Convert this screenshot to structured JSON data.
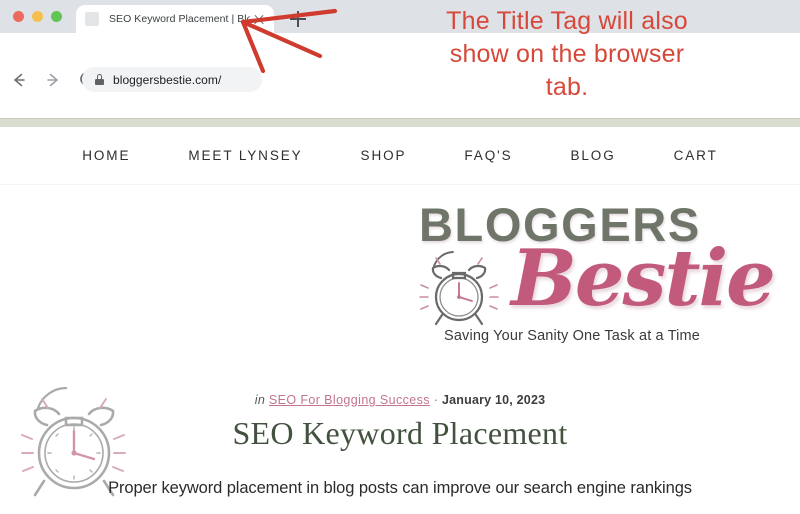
{
  "browser": {
    "traffic_lights": [
      "close",
      "minimize",
      "maximize"
    ],
    "tab": {
      "title": "SEO Keyword Placement | Blo",
      "favicon": "page-icon",
      "close_label": "×"
    },
    "new_tab_label": "+",
    "toolbar": {
      "back_icon": "arrow-left-icon",
      "forward_icon": "arrow-right-icon",
      "reload_icon": "reload-icon",
      "lock_icon": "lock-icon",
      "url": "bloggersbestie.com/"
    }
  },
  "annotation": {
    "text": "The Title Tag will also\nshow on the browser\ntab.",
    "color": "#d6483a",
    "arrow_icon": "arrow-pointing-to-tab"
  },
  "site": {
    "nav": [
      {
        "label": "HOME"
      },
      {
        "label": "MEET LYNSEY"
      },
      {
        "label": "SHOP"
      },
      {
        "label": "FAQ'S"
      },
      {
        "label": "BLOG"
      },
      {
        "label": "CART"
      }
    ],
    "logo": {
      "word_top": "BLOGGERS",
      "word_script": "Bestie",
      "tagline": "Saving Your Sanity One Task at a Time",
      "clock_icon": "alarm-clock-icon",
      "color_top": "#6f7568",
      "color_script": "#c25a7c"
    },
    "watermark_icon": "alarm-clock-watermark-icon"
  },
  "post": {
    "meta_in": "in",
    "category": "SEO For Blogging Success",
    "separator": "·",
    "date": "January 10, 2023",
    "title": "SEO Keyword Placement",
    "lead": "Proper keyword placement in blog posts can improve our search engine rankings"
  }
}
